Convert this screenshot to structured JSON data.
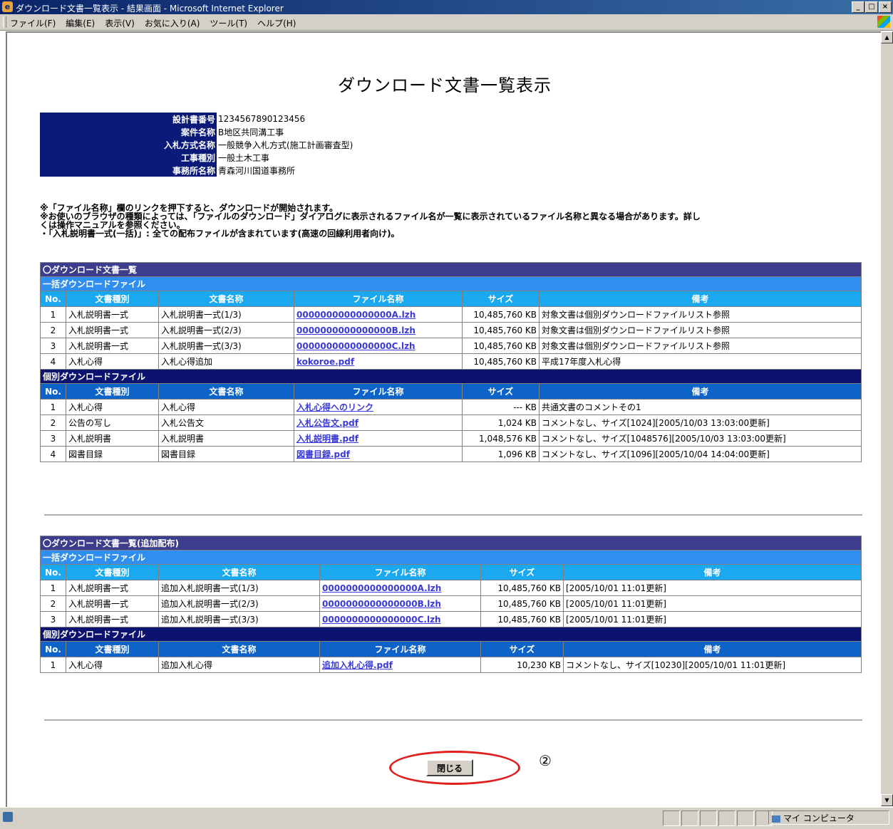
{
  "window": {
    "title": "ダウンロード文書一覧表示 - 結果画面 - Microsoft Internet Explorer",
    "menu": [
      "ファイル(F)",
      "編集(E)",
      "表示(V)",
      "お気に入り(A)",
      "ツール(T)",
      "ヘルプ(H)"
    ],
    "status_zone": "マイ コンピュータ"
  },
  "page": {
    "title": "ダウンロード文書一覧表示",
    "info": [
      {
        "label": "設計書番号",
        "value": "1234567890123456"
      },
      {
        "label": "案件名称",
        "value": "B地区共同溝工事"
      },
      {
        "label": "入札方式名称",
        "value": "一般競争入札方式(施工計画審査型)"
      },
      {
        "label": "工事種別",
        "value": "一般土木工事"
      },
      {
        "label": "事務所名称",
        "value": "青森河川国道事務所"
      }
    ],
    "notes": [
      "※「ファイル名称」欄のリンクを押下すると、ダウンロードが開始されます。",
      "※お使いのブラウザの種類によっては、「ファイルのダウンロード」ダイアログに表示されるファイル名が一覧に表示されているファイル名称と異なる場合があります。詳し",
      "くは操作マニュアルを参照ください。",
      "・「入札説明書一式(一括)」: 全ての配布ファイルが含まれています(高速の回線利用者向け)。"
    ],
    "close_label": "閉じる",
    "callout": "②"
  },
  "columns": [
    "No.",
    "文書種別",
    "文書名称",
    "ファイル名称",
    "サイズ",
    "備考"
  ],
  "table1": {
    "title": "〇ダウンロード文書一覧",
    "bulk_label": "一括ダウンロードファイル",
    "bulk_rows": [
      {
        "no": "1",
        "type": "入札説明書一式",
        "name": "入札説明書一式(1/3)",
        "file": "0000000000000000A.lzh",
        "size": "10,485,760 KB",
        "note": "対象文書は個別ダウンロードファイルリスト参照"
      },
      {
        "no": "2",
        "type": "入札説明書一式",
        "name": "入札説明書一式(2/3)",
        "file": "0000000000000000B.lzh",
        "size": "10,485,760 KB",
        "note": "対象文書は個別ダウンロードファイルリスト参照"
      },
      {
        "no": "3",
        "type": "入札説明書一式",
        "name": "入札説明書一式(3/3)",
        "file": "0000000000000000C.lzh",
        "size": "10,485,760 KB",
        "note": "対象文書は個別ダウンロードファイルリスト参照"
      },
      {
        "no": "4",
        "type": "入札心得",
        "name": "入札心得追加",
        "file": "kokoroe.pdf",
        "size": "10,485,760 KB",
        "note": "平成17年度入札心得"
      }
    ],
    "indiv_label": "個別ダウンロードファイル",
    "indiv_rows": [
      {
        "no": "1",
        "type": "入札心得",
        "name": "入札心得",
        "file": "入札心得へのリンク",
        "size": "--- KB",
        "note": "共通文書のコメントその1"
      },
      {
        "no": "2",
        "type": "公告の写し",
        "name": "入札公告文",
        "file": "入札公告文.pdf",
        "size": "1,024 KB",
        "note": "コメントなし、サイズ[1024][2005/10/03 13:03:00更新]"
      },
      {
        "no": "3",
        "type": "入札説明書",
        "name": "入札説明書",
        "file": "入札説明書.pdf",
        "size": "1,048,576 KB",
        "note": "コメントなし、サイズ[1048576][2005/10/03 13:03:00更新]"
      },
      {
        "no": "4",
        "type": "図書目録",
        "name": "図書目録",
        "file": "図書目録.pdf",
        "size": "1,096 KB",
        "note": "コメントなし、サイズ[1096][2005/10/04 14:04:00更新]"
      }
    ]
  },
  "table2": {
    "title": "〇ダウンロード文書一覧(追加配布)",
    "bulk_label": "一括ダウンロードファイル",
    "bulk_rows": [
      {
        "no": "1",
        "type": "入札説明書一式",
        "name": "追加入札説明書一式(1/3)",
        "file": "0000000000000000A.lzh",
        "size": "10,485,760 KB",
        "note": "[2005/10/01 11:01更新]"
      },
      {
        "no": "2",
        "type": "入札説明書一式",
        "name": "追加入札説明書一式(2/3)",
        "file": "0000000000000000B.lzh",
        "size": "10,485,760 KB",
        "note": "[2005/10/01 11:01更新]"
      },
      {
        "no": "3",
        "type": "入札説明書一式",
        "name": "追加入札説明書一式(3/3)",
        "file": "0000000000000000C.lzh",
        "size": "10,485,760 KB",
        "note": "[2005/10/01 11:01更新]"
      }
    ],
    "indiv_label": "個別ダウンロードファイル",
    "indiv_rows": [
      {
        "no": "1",
        "type": "入札心得",
        "name": "追加入札心得",
        "file": "追加入札心得.pdf",
        "size": "10,230 KB",
        "note": "コメントなし、サイズ[10230][2005/10/01 11:01更新]"
      }
    ]
  }
}
